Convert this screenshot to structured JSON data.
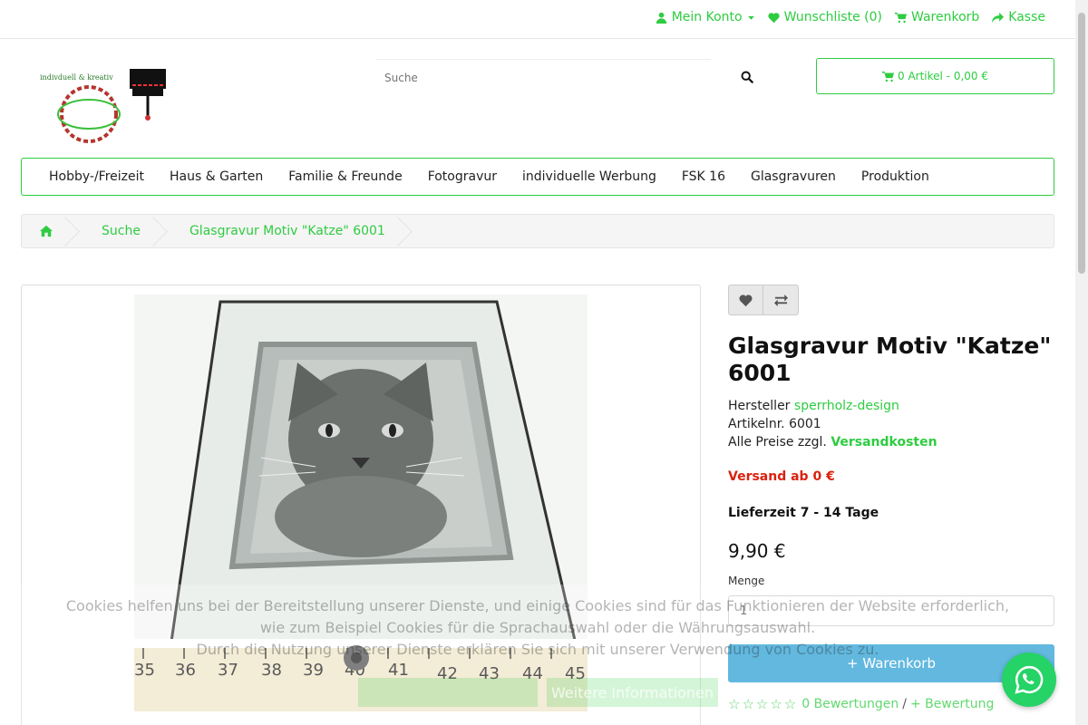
{
  "topnav": {
    "account": "Mein Konto",
    "wishlist": "Wunschliste (0)",
    "cart": "Warenkorb",
    "checkout": "Kasse"
  },
  "header": {
    "search_placeholder": "Suche",
    "cart_summary": "0 Artikel - 0,00 €",
    "logo_text": "indiviuell & kreativ"
  },
  "menu": {
    "items": [
      "Hobby-/Freizeit",
      "Haus & Garten",
      "Familie & Freunde",
      "Fotogravur",
      "individuelle Werbung",
      "FSK 16",
      "Glasgravuren",
      "Produktion"
    ]
  },
  "breadcrumb": {
    "items": [
      "Suche",
      "Glasgravur Motiv \"Katze\" 6001"
    ]
  },
  "product": {
    "title": "Glasgravur Motiv \"Katze\" 6001",
    "manufacturer_label": "Hersteller",
    "manufacturer": "sperrholz-design",
    "sku_label": "Artikelnr. 6001",
    "prices_note": "Alle Preise zzgl.",
    "shipping_link": "Versandkosten",
    "shipping_from": "Versand ab 0 €",
    "delivery_time": "Lieferzeit 7 - 14 Tage",
    "price": "9,90 €",
    "quantity_label": "Menge",
    "quantity_value": "1",
    "add_to_cart": "+ Warenkorb",
    "reviews_count": "0 Bewertungen",
    "reviews_separator": "/",
    "add_review": "+ Bewertung",
    "ruler_numbers": [
      "35",
      "36",
      "37",
      "38",
      "39",
      "40",
      "41",
      "42",
      "43",
      "44",
      "45"
    ]
  },
  "cookie": {
    "line1": "Cookies helfen uns bei der Bereitstellung unserer Dienste, und einige Cookies sind für das Funktionieren der Website erforderlich,",
    "line2": "wie zum Beispiel Cookies für die Sprachauswahl oder die Währungsauswahl.",
    "line3": "Durch die Nutzung unserer Dienste erklären Sie sich mit unserer Verwendung von Cookies zu.",
    "more_info": "Weitere Informationen"
  },
  "colors": {
    "accent": "#2ecc40",
    "cart_button": "#2ea0d4",
    "shipping_red": "#d9210e",
    "whatsapp": "#25d366"
  }
}
